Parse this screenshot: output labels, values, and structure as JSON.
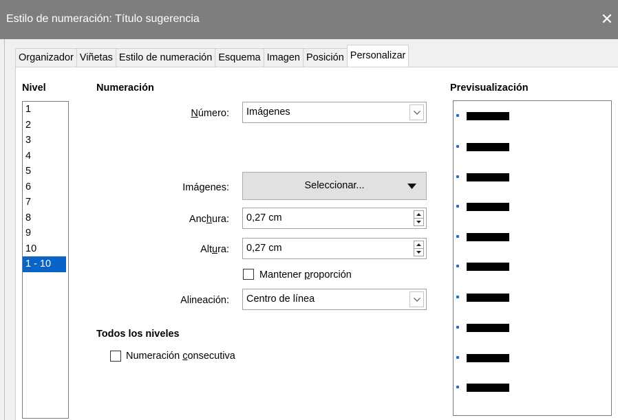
{
  "window": {
    "title": "Estilo de numeración: Título sugerencia",
    "close_glyph": "✕"
  },
  "tabs": [
    "Organizador",
    "Viñetas",
    "Estilo de numeración",
    "Esquema",
    "Imagen",
    "Posición",
    "Personalizar"
  ],
  "active_tab": "Personalizar",
  "level": {
    "heading": "Nivel",
    "items": [
      "1",
      "2",
      "3",
      "4",
      "5",
      "6",
      "7",
      "8",
      "9",
      "10",
      "1 - 10"
    ],
    "selected": "1 - 10"
  },
  "numbering": {
    "heading": "Numeración",
    "numero_label_pre": "",
    "numero_label_u": "N",
    "numero_label_post": "úmero:",
    "numero_value": "Imágenes",
    "imagenes_label": "Imágenes:",
    "select_button": "Seleccionar...",
    "anchura_label_pre": "Anc",
    "anchura_label_u": "h",
    "anchura_label_post": "ura:",
    "anchura_value": "0,27 cm",
    "altura_label_pre": "Alt",
    "altura_label_u": "u",
    "altura_label_post": "ra:",
    "altura_value": "0,27 cm",
    "keep_ratio_pre": "Mantener ",
    "keep_ratio_u": "p",
    "keep_ratio_post": "roporción",
    "keep_ratio_checked": false,
    "alineacion_label": "Alineación:",
    "alineacion_value": "Centro de línea"
  },
  "all_levels": {
    "heading": "Todos los niveles",
    "consecutive_pre": "Numeración ",
    "consecutive_u": "c",
    "consecutive_post": "onsecutiva",
    "consecutive_checked": false
  },
  "preview": {
    "heading": "Previsualización",
    "rows": 10,
    "bullet_color": "#1a6fd6"
  }
}
